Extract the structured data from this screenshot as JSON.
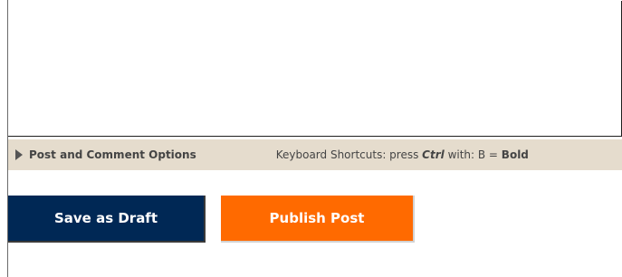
{
  "options_bar": {
    "toggle_label": "Post and Comment Options",
    "shortcuts": {
      "prefix": "Keyboard Shortcuts: press ",
      "key": "Ctrl",
      "middle": " with: B = ",
      "bold_word": "Bold"
    }
  },
  "actions": {
    "save_draft_label": "Save as Draft",
    "publish_label": "Publish Post"
  },
  "colors": {
    "options_bar_bg": "#e5dccd",
    "draft_button_bg": "#002855",
    "publish_button_bg": "#ff6a00"
  }
}
